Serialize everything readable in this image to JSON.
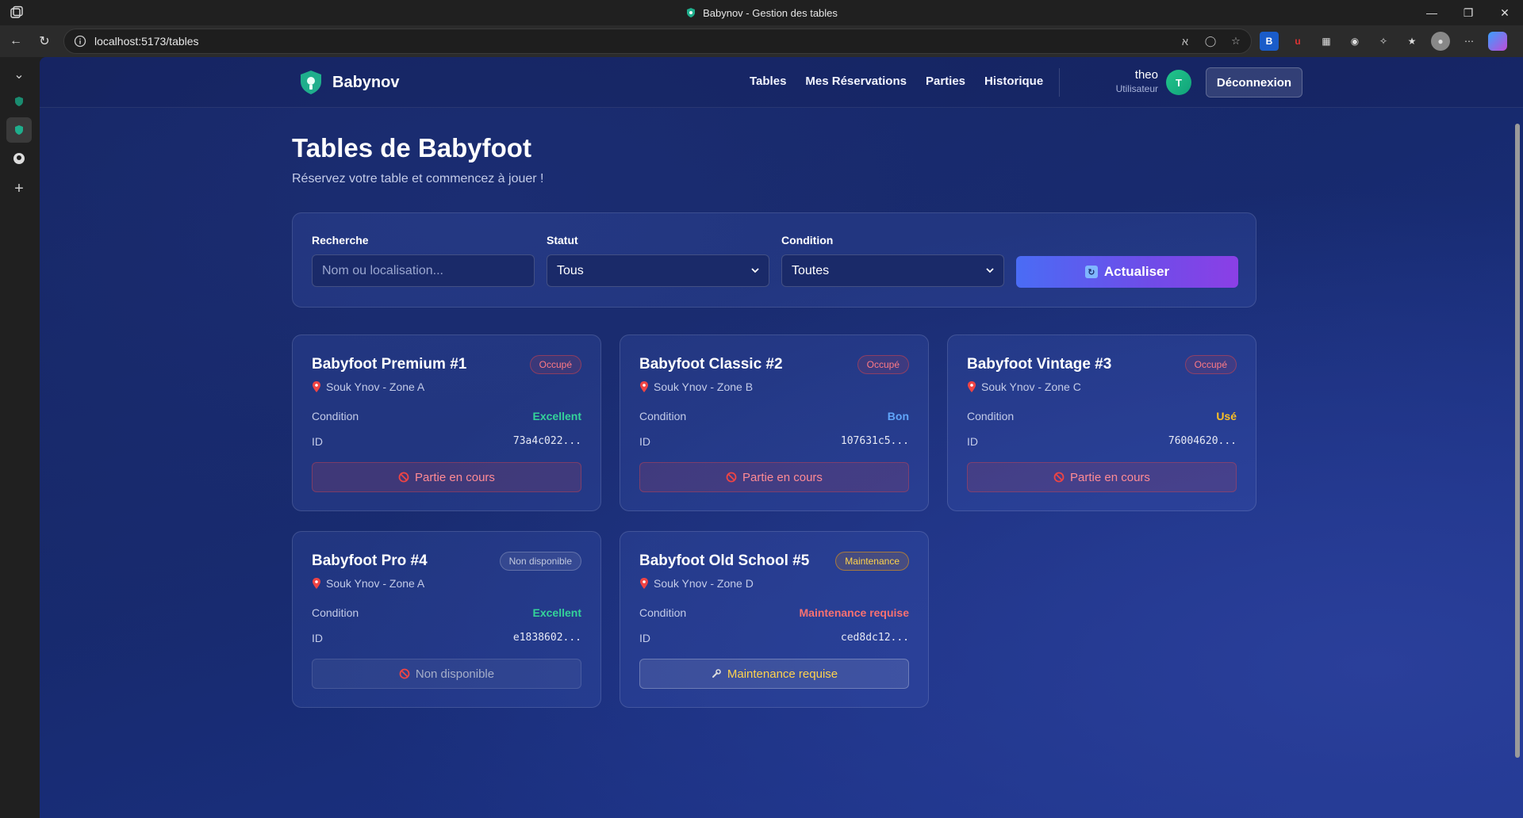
{
  "browser": {
    "window_title": "Babynov - Gestion des tables",
    "url": "localhost:5173/tables"
  },
  "nav": {
    "brand": "Babynov",
    "links": [
      "Tables",
      "Mes Réservations",
      "Parties",
      "Historique"
    ],
    "user_name": "theo",
    "user_role": "Utilisateur",
    "avatar_initial": "T",
    "logout_label": "Déconnexion"
  },
  "header": {
    "title": "Tables de Babyfoot",
    "subtitle": "Réservez votre table et commencez à jouer !"
  },
  "filters": {
    "search_label": "Recherche",
    "search_placeholder": "Nom ou localisation...",
    "status_label": "Statut",
    "status_value": "Tous",
    "condition_label": "Condition",
    "condition_value": "Toutes",
    "refresh_label": "Actualiser"
  },
  "tables": [
    {
      "name": "Babyfoot Premium #1",
      "badge": "Occupé",
      "location": "Souk Ynov - Zone A",
      "condition_label": "Condition",
      "condition": "Excellent",
      "id_label": "ID",
      "id": "73a4c022...",
      "action": "Partie en cours"
    },
    {
      "name": "Babyfoot Classic #2",
      "badge": "Occupé",
      "location": "Souk Ynov - Zone B",
      "condition_label": "Condition",
      "condition": "Bon",
      "id_label": "ID",
      "id": "107631c5...",
      "action": "Partie en cours"
    },
    {
      "name": "Babyfoot Vintage #3",
      "badge": "Occupé",
      "location": "Souk Ynov - Zone C",
      "condition_label": "Condition",
      "condition": "Usé",
      "id_label": "ID",
      "id": "76004620...",
      "action": "Partie en cours"
    },
    {
      "name": "Babyfoot Pro #4",
      "badge": "Non disponible",
      "location": "Souk Ynov - Zone A",
      "condition_label": "Condition",
      "condition": "Excellent",
      "id_label": "ID",
      "id": "e1838602...",
      "action": "Non disponible"
    },
    {
      "name": "Babyfoot Old School #5",
      "badge": "Maintenance",
      "location": "Souk Ynov - Zone D",
      "condition_label": "Condition",
      "condition": "Maintenance requise",
      "id_label": "ID",
      "id": "ced8dc12...",
      "action": "Maintenance requise"
    }
  ],
  "colors": {
    "occupied": "#ff7a85",
    "excellent": "#34d399",
    "bon": "#60a5fa",
    "use": "#fbbf24",
    "maintenance": "#ffd34d"
  }
}
